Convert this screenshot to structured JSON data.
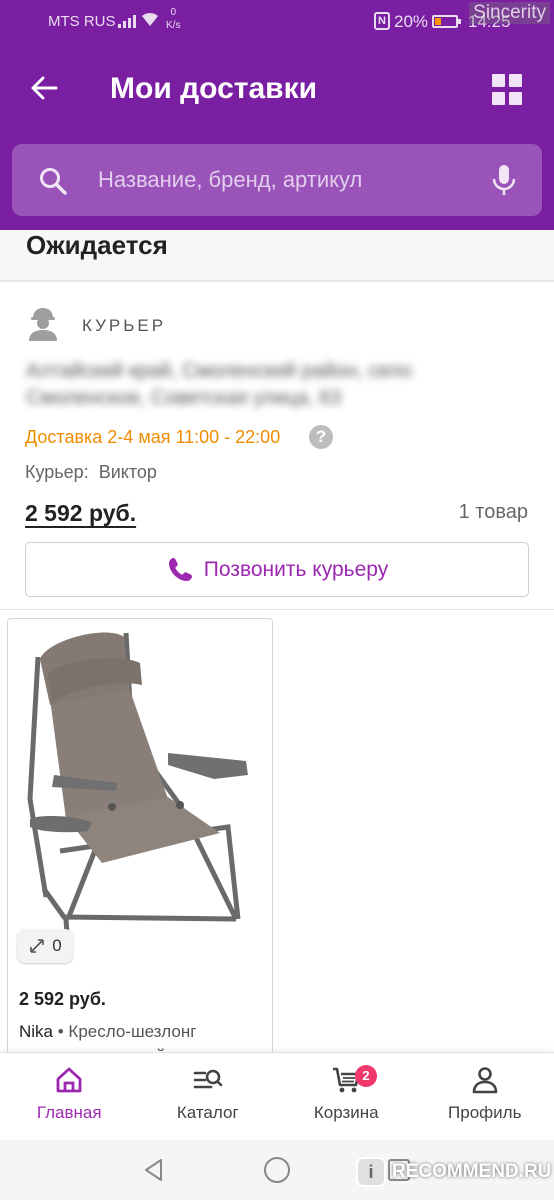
{
  "status_bar": {
    "carrier": "MTS RUS",
    "speed_value": "0",
    "speed_unit": "K/s",
    "nfc": "N",
    "battery": "20%",
    "time": "14:25",
    "battery_color": "#ff9800"
  },
  "watermark_top": "Sincerity",
  "header": {
    "title": "Мои доставки",
    "background": "#7b1fa2"
  },
  "search": {
    "placeholder": "Название, бренд, артикул"
  },
  "section": {
    "title": "Ожидается"
  },
  "delivery": {
    "method": "КУРЬЕР",
    "address": "Алтайский край, Смоленский район, село Смоленское, Советская улица, 63",
    "time": "Доставка 2-4 мая 11:00 - 22:00",
    "help": "?",
    "courier_label": "Курьер:",
    "courier_name": "Виктор",
    "price": "2 592 руб.",
    "items": "1 товар",
    "call_button": "Позвонить курьеру"
  },
  "product": {
    "zoom_count": "0",
    "price": "2 592 руб.",
    "brand": "Nika",
    "separator": " • ",
    "name": "Кресло-шезлонг складное с полкой и съе..."
  },
  "bottom_nav": {
    "items": [
      {
        "label": "Главная",
        "icon": "home-icon",
        "active": true
      },
      {
        "label": "Каталог",
        "icon": "catalog-search-icon",
        "active": false
      },
      {
        "label": "Корзина",
        "icon": "cart-icon",
        "active": false,
        "badge": "2"
      },
      {
        "label": "Профиль",
        "icon": "profile-icon",
        "active": false
      }
    ]
  },
  "watermark_bottom": {
    "logo": "i",
    "text": "RECOMMEND.RU"
  },
  "colors": {
    "accent": "#9c27b0",
    "delivery_time": "#f08c00",
    "badge": "#f0386b"
  }
}
